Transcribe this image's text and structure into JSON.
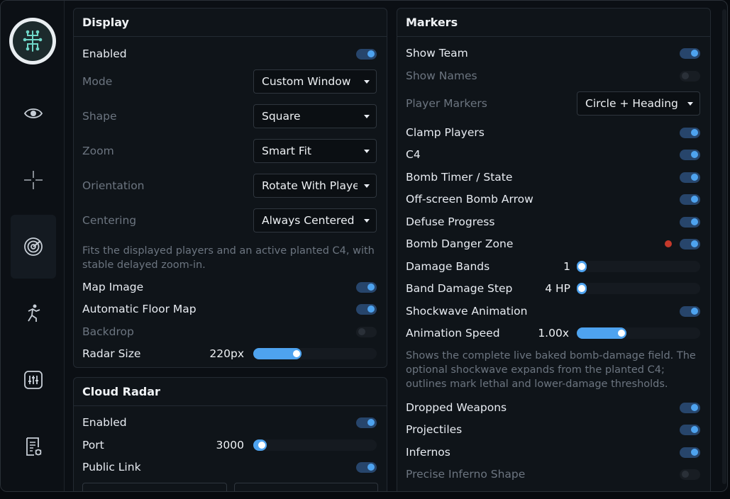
{
  "display": {
    "title": "Display",
    "enabled_label": "Enabled",
    "mode_label": "Mode",
    "mode_value": "Custom Window",
    "shape_label": "Shape",
    "shape_value": "Square",
    "zoom_label": "Zoom",
    "zoom_value": "Smart Fit",
    "orientation_label": "Orientation",
    "orientation_value": "Rotate With Player",
    "centering_label": "Centering",
    "centering_value": "Always Centered",
    "note": "Fits the displayed players and an active planted C4, with stable delayed zoom-in.",
    "map_image_label": "Map Image",
    "auto_floor_label": "Automatic Floor Map",
    "backdrop_label": "Backdrop",
    "radar_size_label": "Radar Size",
    "radar_size_value": "220px",
    "radar_size_fraction": 0.34
  },
  "cloud": {
    "title": "Cloud Radar",
    "enabled_label": "Enabled",
    "port_label": "Port",
    "port_value": "3000",
    "port_fraction": 0.03,
    "public_link_label": "Public Link"
  },
  "markers": {
    "title": "Markers",
    "show_team": "Show Team",
    "show_names": "Show Names",
    "player_markers_label": "Player Markers",
    "player_markers_value": "Circle + Heading",
    "clamp_players": "Clamp Players",
    "c4": "C4",
    "bomb_timer": "Bomb Timer / State",
    "offscreen_arrow": "Off-screen Bomb Arrow",
    "defuse_progress": "Defuse Progress",
    "bomb_danger_zone": "Bomb Danger Zone",
    "damage_bands_label": "Damage Bands",
    "damage_bands_value": "1",
    "damage_bands_fraction": 0.0,
    "band_step_label": "Band Damage Step",
    "band_step_value": "4 HP",
    "band_step_fraction": 0.0,
    "shockwave_animation": "Shockwave Animation",
    "animation_speed_label": "Animation Speed",
    "animation_speed_value": "1.00x",
    "animation_speed_fraction": 0.35,
    "note": "Shows the complete live baked bomb-damage field. The optional shockwave expands from the planted C4; outlines mark lethal and lower-damage thresholds.",
    "dropped_weapons": "Dropped Weapons",
    "projectiles": "Projectiles",
    "infernos": "Infernos",
    "precise_inferno": "Precise Inferno Shape"
  },
  "colors": {
    "accent": "#4ea3ef",
    "danger": "#c4392b"
  }
}
